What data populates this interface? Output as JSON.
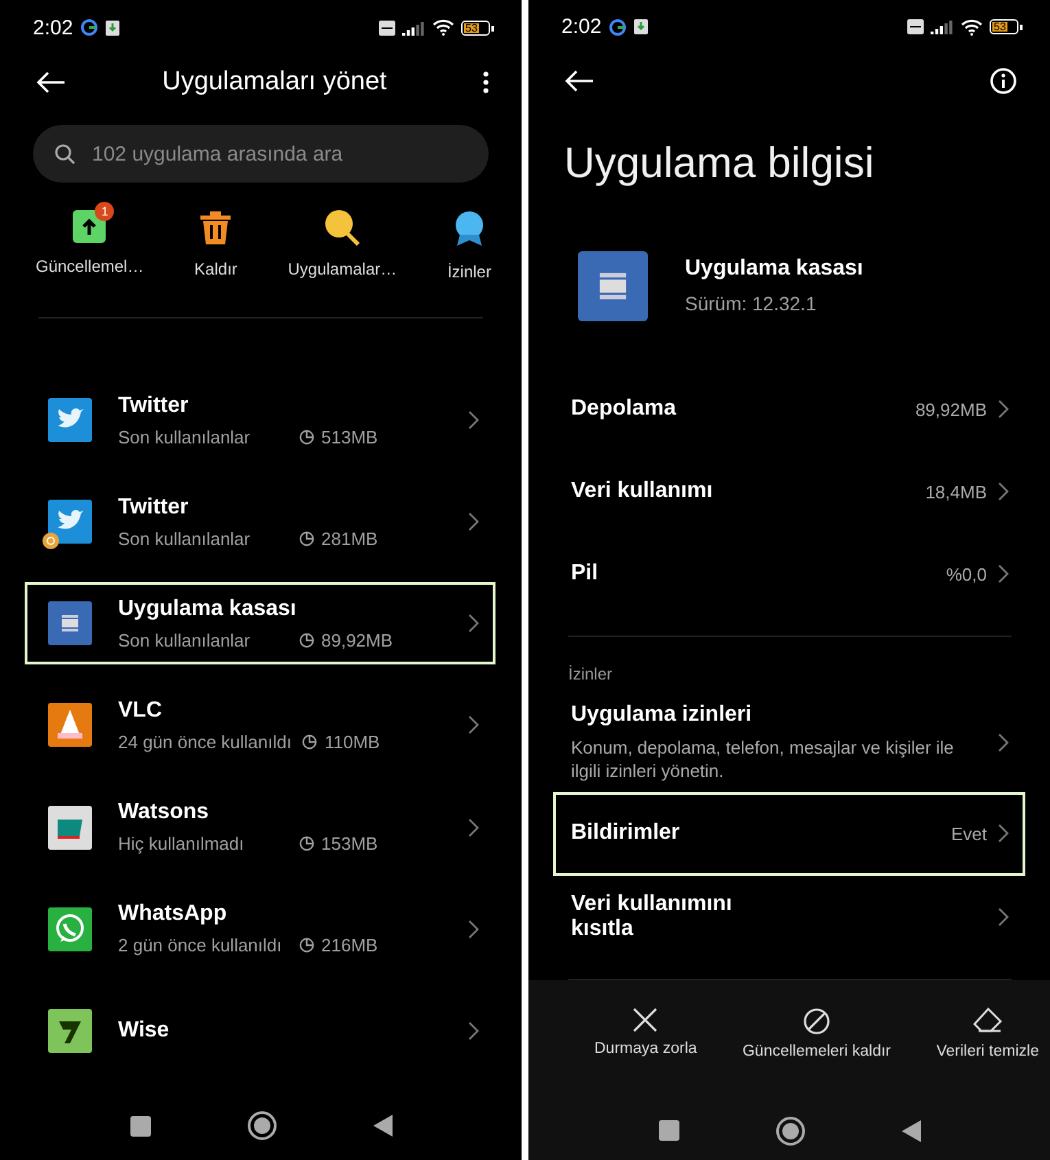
{
  "left_screen": {
    "status_bar": {
      "time": "2:02",
      "battery": "53"
    },
    "title": "Uygulamaları yönet",
    "search": {
      "placeholder": "102 uygulama arasında ara"
    },
    "quick_actions": [
      {
        "label": "Güncellemel…",
        "kind": "update",
        "badge": "1"
      },
      {
        "label": "Kaldır",
        "kind": "uninstall"
      },
      {
        "label": "Uygulamalar…",
        "kind": "apps"
      },
      {
        "label": "İzinler",
        "kind": "permissions"
      }
    ],
    "apps": [
      {
        "name": "Twitter",
        "kind": "twitter",
        "last_used": "Son kullanılanlar",
        "size": "513MB",
        "highlighted": false,
        "clone": false
      },
      {
        "name": "Twitter",
        "kind": "twitter",
        "last_used": "Son kullanılanlar",
        "size": "281MB",
        "highlighted": false,
        "clone": true
      },
      {
        "name": "Uygulama kasası",
        "kind": "vault",
        "last_used": "Son kullanılanlar",
        "size": "89,92MB",
        "highlighted": true,
        "clone": false
      },
      {
        "name": "VLC",
        "kind": "vlc",
        "last_used": "24 gün önce kullanıldı",
        "size": "110MB",
        "highlighted": false,
        "clone": false
      },
      {
        "name": "Watsons",
        "kind": "watsons",
        "last_used": "Hiç kullanılmadı",
        "size": "153MB",
        "highlighted": false,
        "clone": false
      },
      {
        "name": "WhatsApp",
        "kind": "whatsapp",
        "last_used": "2 gün önce kullanıldı",
        "size": "216MB",
        "highlighted": false,
        "clone": false
      },
      {
        "name": "Wise",
        "kind": "wise",
        "highlighted": false,
        "clone": false
      }
    ]
  },
  "right_screen": {
    "status_bar": {
      "time": "2:02",
      "battery": "53"
    },
    "title": "Uygulama bilgisi",
    "app": {
      "name": "Uygulama kasası",
      "version": "Sürüm: 12.32.1"
    },
    "info_rows": [
      {
        "label": "Depolama",
        "value": "89,92MB"
      },
      {
        "label": "Veri kullanımı",
        "value": "18,4MB"
      },
      {
        "label": "Pil",
        "value": "%0,0"
      }
    ],
    "section_title": "İzinler",
    "permission_rows": [
      {
        "label": "Uygulama izinleri",
        "subtitle": "Konum, depolama, telefon, mesajlar ve kişiler ile ilgili izinleri yönetin.",
        "highlighted": false
      },
      {
        "label": "Bildirimler",
        "value": "Evet",
        "highlighted": true
      },
      {
        "label": "Veri kullanımını kısıtla",
        "highlighted": false
      }
    ],
    "actions": [
      {
        "label": "Durmaya zorla",
        "kind": "close"
      },
      {
        "label": "Güncellemeleri kaldır",
        "kind": "block"
      },
      {
        "label": "Verileri temizle",
        "kind": "eraser"
      }
    ]
  }
}
